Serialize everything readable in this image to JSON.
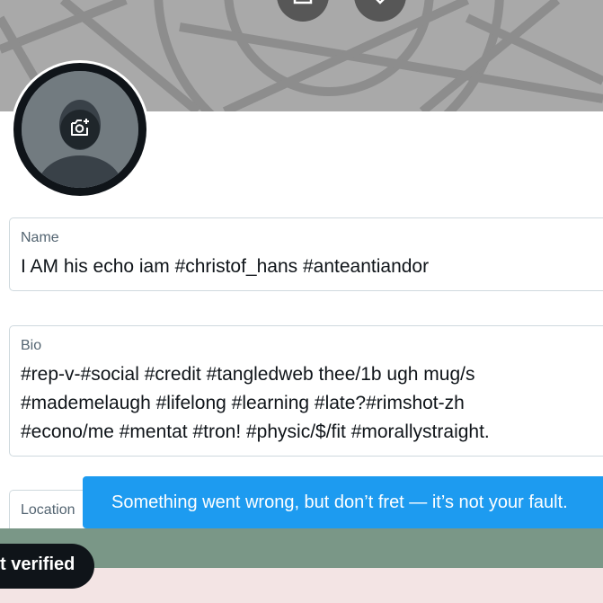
{
  "banner": {
    "camera_icon": "camera-plus-icon",
    "close_icon": "close-icon",
    "background_color": "#a9a9a9"
  },
  "avatar": {
    "icon": "camera-plus-icon"
  },
  "fields": {
    "name": {
      "label": "Name",
      "value": "I AM his echo iam #christof_hans #anteantiandor"
    },
    "bio": {
      "label": "Bio",
      "lines": [
        "#rep-v-#social #credit #tangledweb thee/1b ugh mug/s",
        "#mademelaugh #lifelong #learning #late?#rimshot-zh",
        "#econo/me #mentat #tron! #physic/$/fit #morallystraight."
      ]
    },
    "location": {
      "label": "Location"
    }
  },
  "verified_label": "t verified",
  "toast": {
    "message": "Something went wrong, but don’t fret — it’s not your fault.",
    "color": "#1d9bf0"
  }
}
